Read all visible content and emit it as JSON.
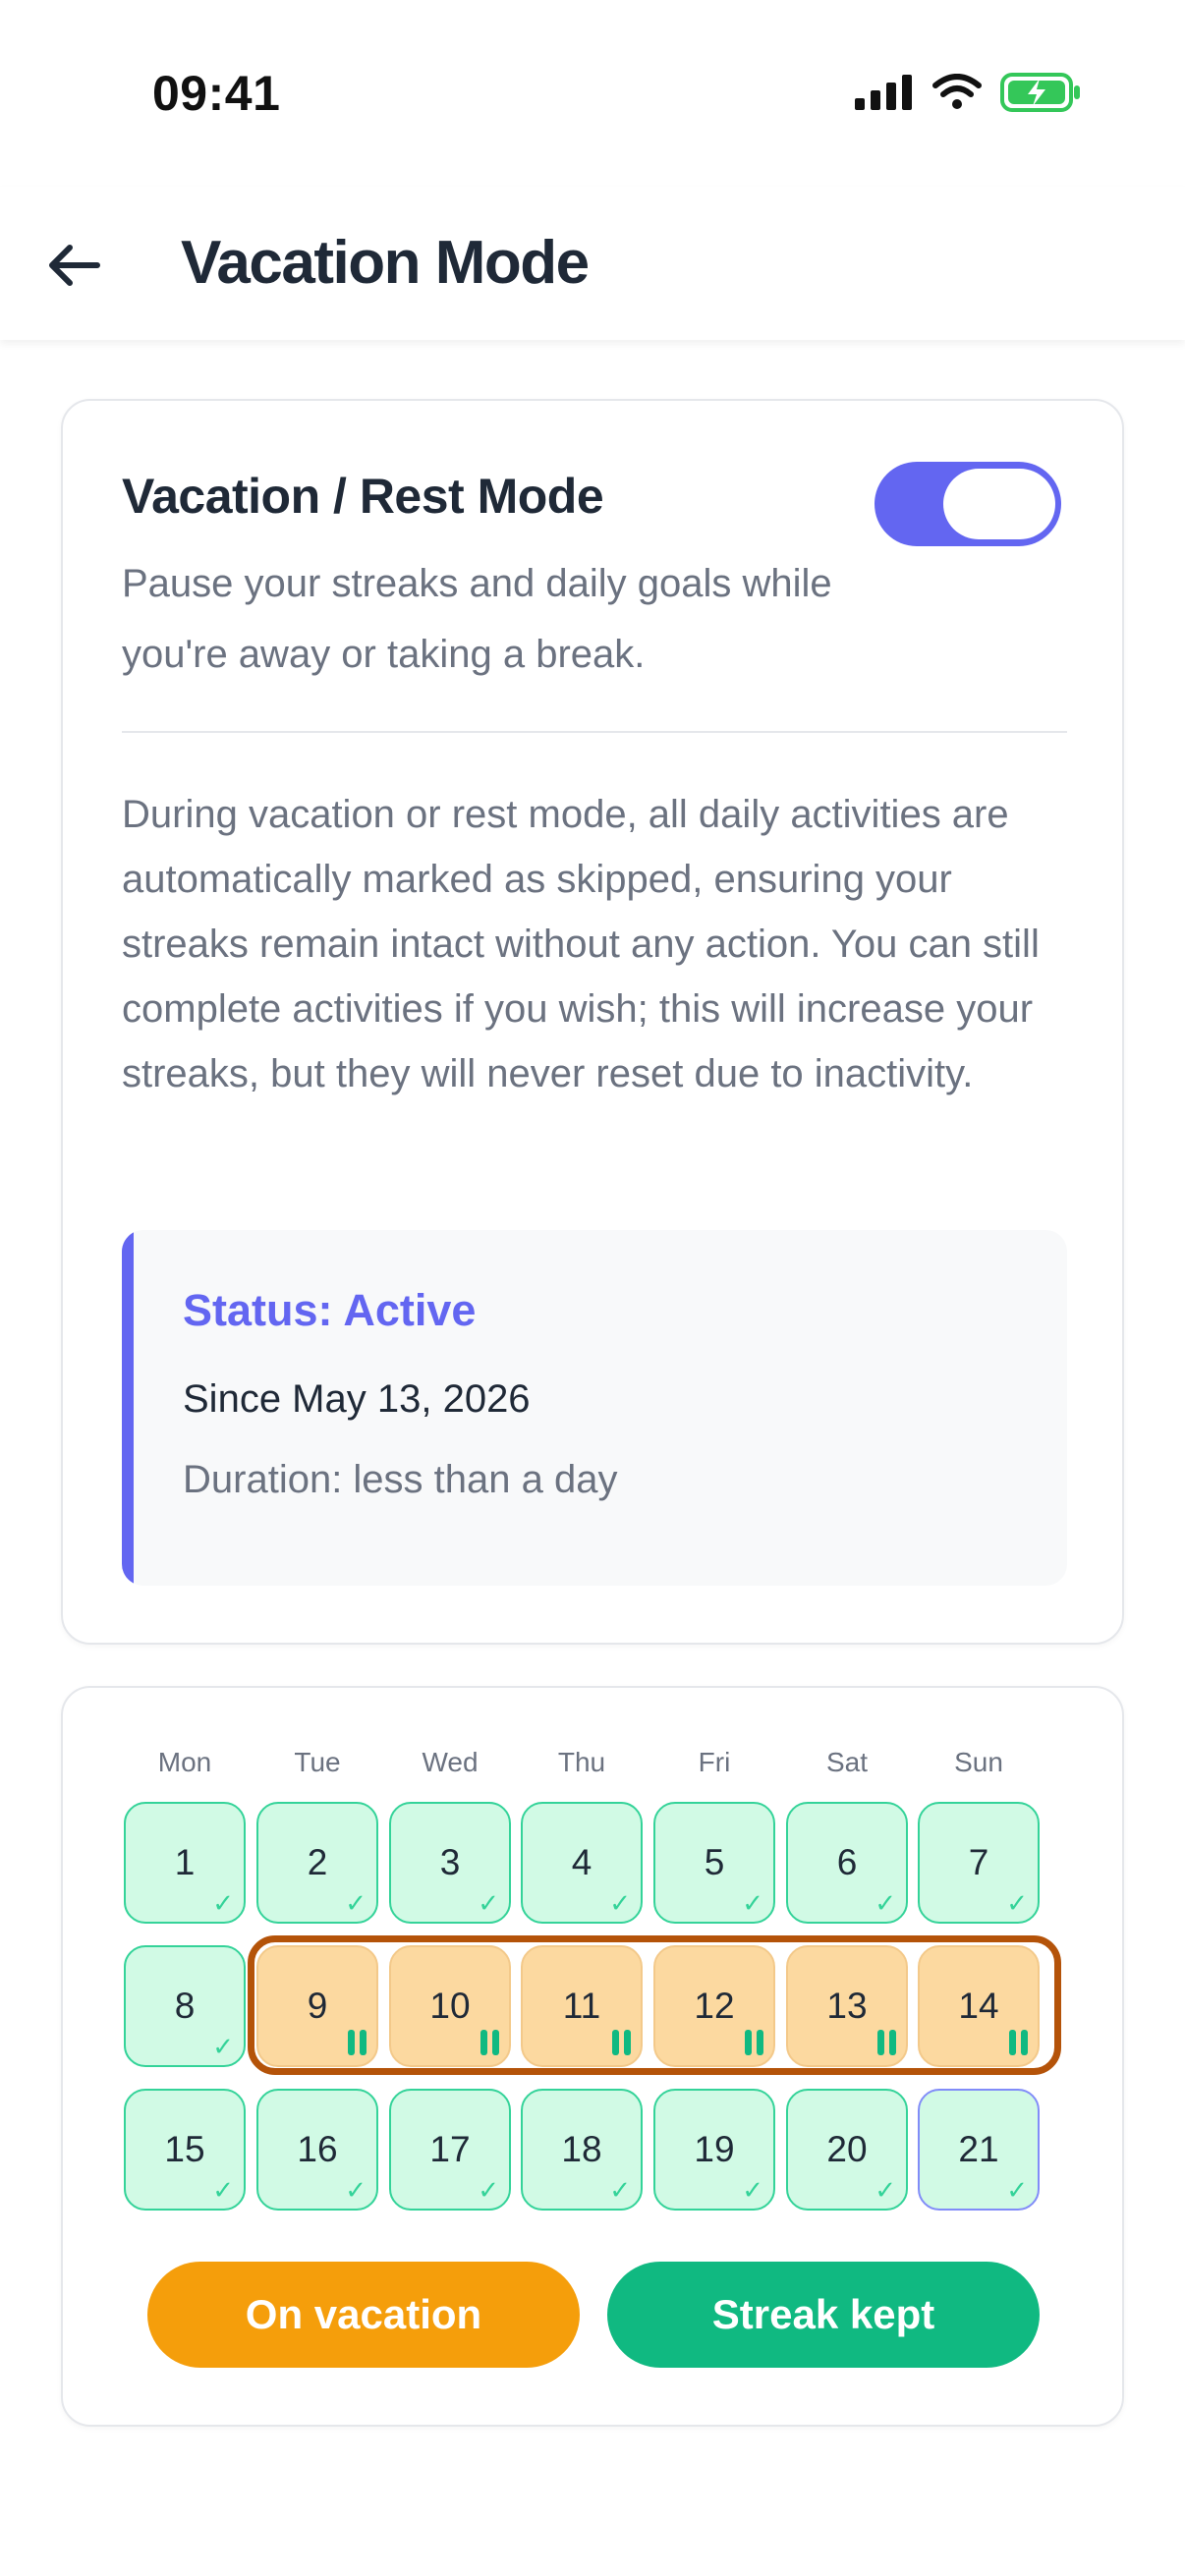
{
  "status_bar": {
    "time": "09:41"
  },
  "header": {
    "title": "Vacation Mode"
  },
  "settings": {
    "title": "Vacation / Rest Mode",
    "subtitle": "Pause your streaks and daily goals while you're away or taking a break.",
    "toggle_on": true,
    "description": "During vacation or rest mode, all daily activities are automatically marked as skipped, ensuring your streaks remain intact without any action. You can still complete activities if you wish; this will increase your streaks, but they will never reset due to inactivity.",
    "status": {
      "title": "Status: Active",
      "since": "Since May 13, 2026",
      "duration": "Duration: less than a day"
    }
  },
  "calendar": {
    "weekdays": [
      "Mon",
      "Tue",
      "Wed",
      "Thu",
      "Fri",
      "Sat",
      "Sun"
    ],
    "weeks": [
      [
        {
          "day": "1",
          "state": "kept"
        },
        {
          "day": "2",
          "state": "kept"
        },
        {
          "day": "3",
          "state": "kept"
        },
        {
          "day": "4",
          "state": "kept"
        },
        {
          "day": "5",
          "state": "kept"
        },
        {
          "day": "6",
          "state": "kept"
        },
        {
          "day": "7",
          "state": "kept"
        }
      ],
      [
        {
          "day": "8",
          "state": "kept"
        },
        {
          "day": "9",
          "state": "vacation"
        },
        {
          "day": "10",
          "state": "vacation"
        },
        {
          "day": "11",
          "state": "vacation"
        },
        {
          "day": "12",
          "state": "vacation"
        },
        {
          "day": "13",
          "state": "vacation"
        },
        {
          "day": "14",
          "state": "vacation"
        }
      ],
      [
        {
          "day": "15",
          "state": "kept"
        },
        {
          "day": "16",
          "state": "kept"
        },
        {
          "day": "17",
          "state": "kept"
        },
        {
          "day": "18",
          "state": "kept"
        },
        {
          "day": "19",
          "state": "kept"
        },
        {
          "day": "20",
          "state": "kept"
        },
        {
          "day": "21",
          "state": "today"
        }
      ]
    ],
    "legend": {
      "vacation_label": "On vacation",
      "kept_label": "Streak kept"
    }
  },
  "colors": {
    "accent": "#6366f1",
    "vacation": "#f59e0b",
    "kept": "#10b981"
  }
}
